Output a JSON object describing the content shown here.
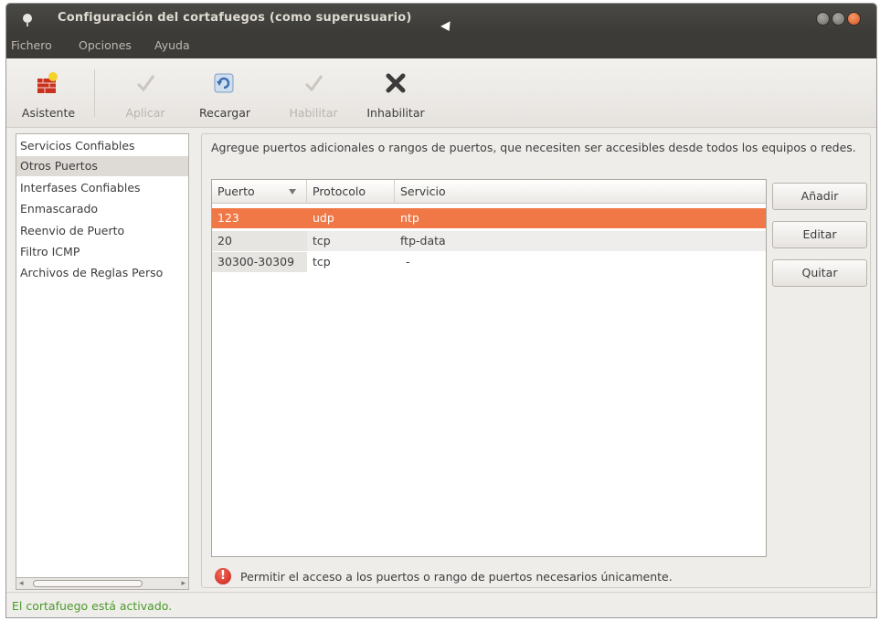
{
  "window": {
    "title": "Configuración del cortafuegos (como superusuario)"
  },
  "menubar": {
    "items": [
      "Fichero",
      "Opciones",
      "Ayuda"
    ]
  },
  "toolbar": {
    "wizard": {
      "label": "Asistente",
      "icon": "wizard-wall-icon",
      "enabled": true
    },
    "apply": {
      "label": "Aplicar",
      "icon": "checkmark-icon",
      "enabled": false
    },
    "reload": {
      "label": "Recargar",
      "icon": "reload-icon",
      "enabled": true
    },
    "enable": {
      "label": "Habilitar",
      "icon": "checkmark-icon",
      "enabled": false
    },
    "disable": {
      "label": "Inhabilitar",
      "icon": "close-x-icon",
      "enabled": true
    }
  },
  "sidebar": {
    "items": [
      {
        "label": "Servicios Confiables",
        "selected": false
      },
      {
        "label": "Otros Puertos",
        "selected": true
      },
      {
        "label": "Interfases Confiables",
        "selected": false
      },
      {
        "label": "Enmascarado",
        "selected": false
      },
      {
        "label": "Reenvio de Puerto",
        "selected": false
      },
      {
        "label": "Filtro ICMP",
        "selected": false
      },
      {
        "label": "Archivos de Reglas Perso",
        "selected": false
      }
    ]
  },
  "main": {
    "description": "Agregue puertos adicionales o rangos de puertos, que necesiten ser accesibles desde todos los equipos o redes.",
    "table": {
      "columns": [
        "Puerto",
        "Protocolo",
        "Servicio"
      ],
      "sort_column": "Puerto",
      "rows": [
        {
          "port": "123",
          "protocol": "udp",
          "service": "ntp",
          "selected": true
        },
        {
          "port": "20",
          "protocol": "tcp",
          "service": "ftp-data",
          "selected": false
        },
        {
          "port": "30300-30309",
          "protocol": "tcp",
          "service": "-",
          "selected": false
        }
      ]
    },
    "buttons": {
      "add": "Añadir",
      "edit": "Editar",
      "remove": "Quitar"
    },
    "warning": "Permitir el acceso a los puertos o rango de puertos necesarios únicamente."
  },
  "statusbar": {
    "text": "El cortafuego está activado."
  },
  "colors": {
    "selection": "#f07746",
    "status_ok": "#4a9a2a",
    "titlebar": "#3c3b37"
  }
}
